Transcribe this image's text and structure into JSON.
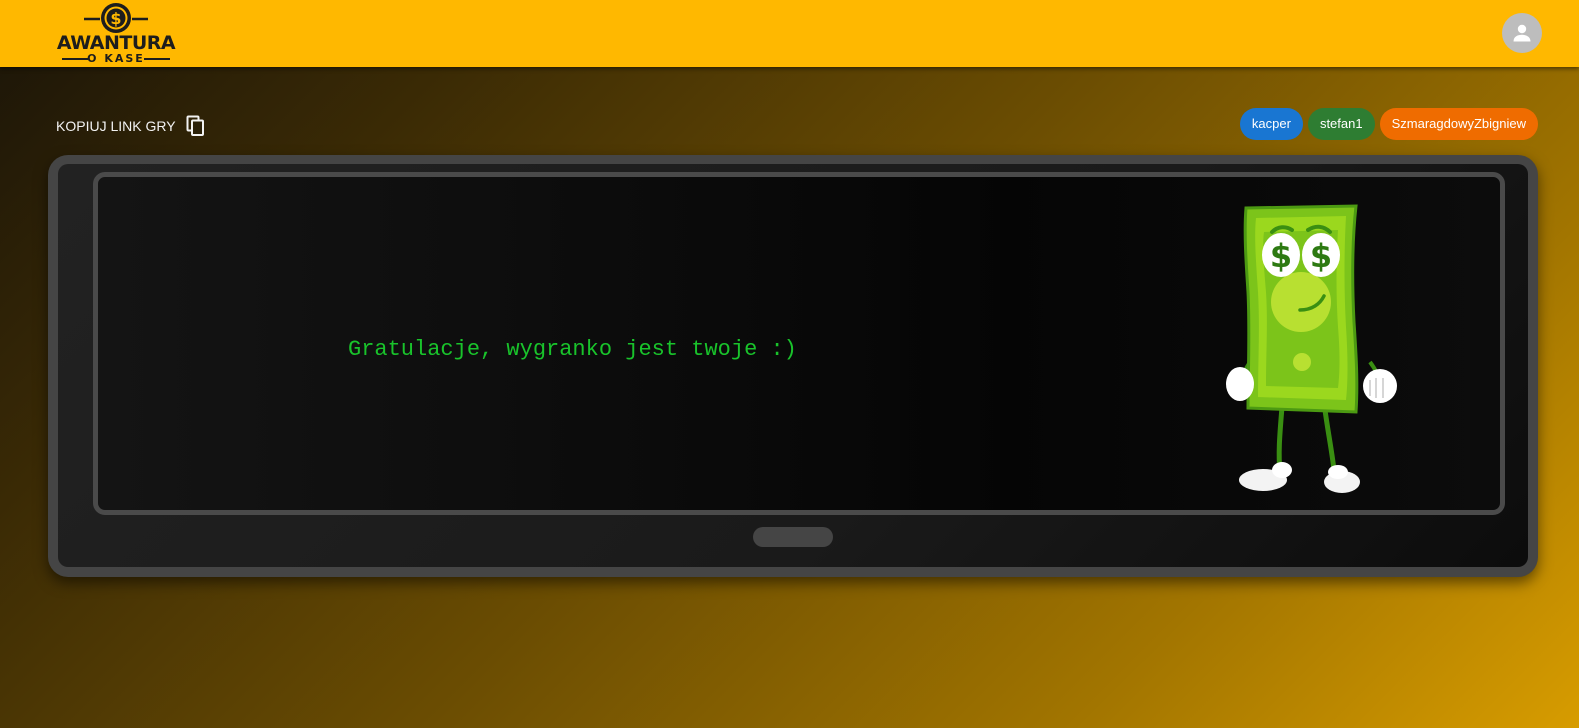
{
  "header": {
    "logo_title": "AWANTURA",
    "logo_subtitle": "O KASE",
    "logo_icon": "dollar-coin-icon",
    "avatar_icon": "person-icon",
    "colors": {
      "bar": "#ffb800"
    }
  },
  "toolbar": {
    "copy_link_label": "KOPIUJ LINK GRY",
    "copy_icon": "copy-icon"
  },
  "players": [
    {
      "name": "kacper",
      "color": "#1976d2"
    },
    {
      "name": "stefan1",
      "color": "#2e7d32"
    },
    {
      "name": "SzmaragdowyZbigniew",
      "color": "#ef6c00"
    }
  ],
  "screen": {
    "message": "Gratulacje, wygranko jest twoje :)",
    "message_color": "#19c32b",
    "mascot": "dollar-bill-mascot"
  }
}
